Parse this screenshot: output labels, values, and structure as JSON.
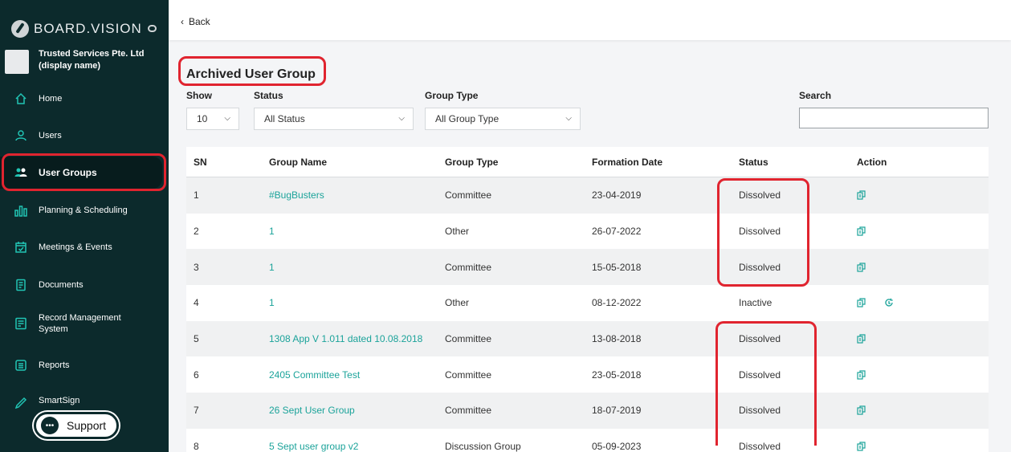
{
  "brand": {
    "logo_text": "BOARD.VISION"
  },
  "org": {
    "name": "Trusted Services Pte. Ltd (display name)"
  },
  "nav": [
    {
      "label": "Home",
      "icon": "home-icon"
    },
    {
      "label": "Users",
      "icon": "user-icon"
    },
    {
      "label": "User Groups",
      "icon": "users-icon",
      "active": true
    },
    {
      "label": "Planning & Scheduling",
      "icon": "bar-chart-icon"
    },
    {
      "label": "Meetings & Events",
      "icon": "calendar-icon"
    },
    {
      "label": "Documents",
      "icon": "document-icon"
    },
    {
      "label": "Record Management System",
      "icon": "record-icon"
    },
    {
      "label": "Reports",
      "icon": "report-icon"
    },
    {
      "label": "SmartSign",
      "icon": "pen-icon"
    }
  ],
  "support_label": "Support",
  "topbar": {
    "back_label": "Back"
  },
  "page_title": "Archived User Group",
  "filters": {
    "show_label": "Show",
    "show_value": "10",
    "status_label": "Status",
    "status_value": "All Status",
    "group_type_label": "Group Type",
    "group_type_value": "All Group Type",
    "search_label": "Search",
    "search_value": ""
  },
  "table": {
    "headers": [
      "SN",
      "Group Name",
      "Group Type",
      "Formation Date",
      "Status",
      "Action"
    ],
    "rows": [
      {
        "sn": "1",
        "name": "#BugBusters",
        "type": "Committee",
        "date": "23-04-2019",
        "status": "Dissolved",
        "actions": [
          "copy"
        ]
      },
      {
        "sn": "2",
        "name": "1",
        "type": "Other",
        "date": "26-07-2022",
        "status": "Dissolved",
        "actions": [
          "copy"
        ]
      },
      {
        "sn": "3",
        "name": "1",
        "type": "Committee",
        "date": "15-05-2018",
        "status": "Dissolved",
        "actions": [
          "copy"
        ]
      },
      {
        "sn": "4",
        "name": "1",
        "type": "Other",
        "date": "08-12-2022",
        "status": "Inactive",
        "actions": [
          "copy",
          "restore"
        ]
      },
      {
        "sn": "5",
        "name": "1308 App V 1.011 dated 10.08.2018",
        "type": "Committee",
        "date": "13-08-2018",
        "status": "Dissolved",
        "actions": [
          "copy"
        ]
      },
      {
        "sn": "6",
        "name": "2405 Committee Test",
        "type": "Committee",
        "date": "23-05-2018",
        "status": "Dissolved",
        "actions": [
          "copy"
        ]
      },
      {
        "sn": "7",
        "name": "26 Sept User Group",
        "type": "Committee",
        "date": "18-07-2019",
        "status": "Dissolved",
        "actions": [
          "copy"
        ]
      },
      {
        "sn": "8",
        "name": "5 Sept user group v2",
        "type": "Discussion Group",
        "date": "05-09-2023",
        "status": "Dissolved",
        "actions": [
          "copy"
        ]
      }
    ]
  },
  "colors": {
    "sidebar_bg": "#0c2a2c",
    "accent": "#1ba39a",
    "highlight": "#e0242f"
  }
}
